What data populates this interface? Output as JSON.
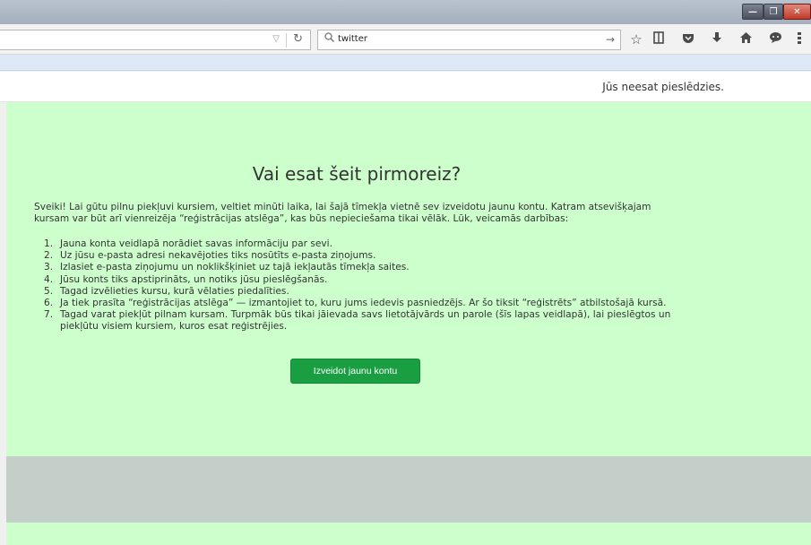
{
  "browser": {
    "window_buttons": {
      "minimize": "—",
      "maximize": "❐",
      "close": "✕"
    },
    "url_dropdown_icon": "▽",
    "reload_icon": "↻",
    "search": {
      "query": "twitter",
      "icon": "search-icon"
    },
    "search_go_icon": "→",
    "toolbar_icons": [
      "star-icon",
      "reading-list-icon",
      "pocket-icon",
      "download-icon",
      "home-icon",
      "chat-icon",
      "menu-icon"
    ]
  },
  "header": {
    "login_status": "Jūs neesat pieslēdzies."
  },
  "main": {
    "heading": "Vai esat šeit pirmoreiz?",
    "intro": "Sveiki! Lai gūtu pilnu piekļuvi kursiem, veltiet minūti laika, lai šajā tīmekļa vietnē sev izveidotu jaunu kontu. Katram atsevišķajam kursam var būt arī vienreizēja “reģistrācijas atslēga”, kas būs nepieciešama tikai vēlāk. Lūk, veicamās darbības:",
    "steps": [
      {
        "num": "1.",
        "text": "Jauna konta veidlapā norādiet savas informāciju par sevi."
      },
      {
        "num": "2.",
        "text": "Uz jūsu e-pasta adresi nekavējoties tiks nosūtīts e-pasta ziņojums."
      },
      {
        "num": "3.",
        "text": "Izlasiet e-pasta ziņojumu un noklikšķiniet uz tajā iekļautās tīmekļa saites."
      },
      {
        "num": "4.",
        "text": "Jūsu konts tiks apstiprināts, un notiks jūsu pieslēgšanās."
      },
      {
        "num": "5.",
        "text": "Tagad izvēlieties kursu, kurā vēlaties piedalīties."
      },
      {
        "num": "6.",
        "text": "Ja tiek prasīta “reģistrācijas atslēga” — izmantojiet to, kuru jums iedevis pasniedzējs. Ar šo tiksit “reģistrēts” atbilstošajā kursā."
      },
      {
        "num": "7.",
        "text": "Tagad varat piekļūt pilnam kursam. Turpmāk būs tikai jāievada savs lietotājvārds un parole (šīs lapas veidlapā), lai pieslēgtos un piekļūtu visiem kursiem, kuros esat reģistrējies."
      }
    ],
    "signup_button": "Izveidot jaunu kontu"
  },
  "colors": {
    "main_bg": "#ccffcc",
    "button_bg": "#1a9e42",
    "footer_band": "#c4cfca"
  }
}
